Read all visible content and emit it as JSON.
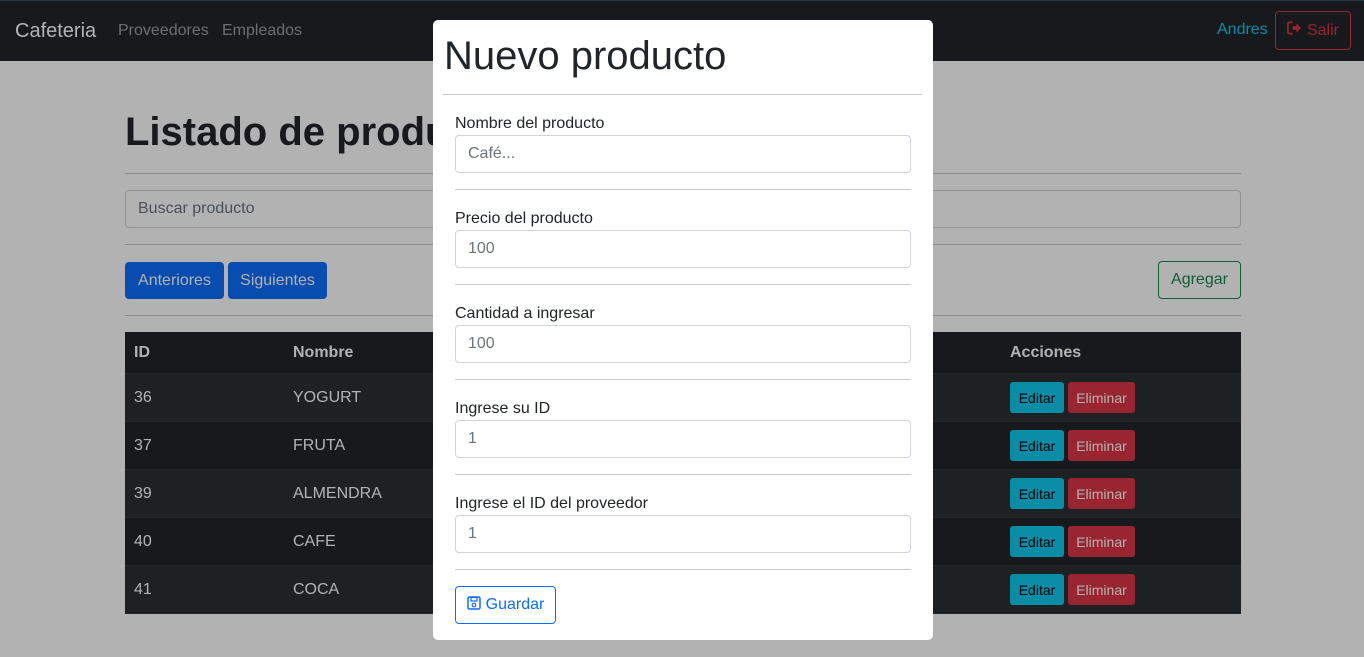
{
  "navbar": {
    "brand": "Cafeteria",
    "links": [
      "Proveedores",
      "Empleados"
    ],
    "user": "Andres",
    "logout_label": "Salir"
  },
  "page": {
    "title": "Listado de productos",
    "search_placeholder": "Buscar producto",
    "prev_label": "Anteriores",
    "next_label": "Siguientes",
    "add_label": "Agregar"
  },
  "table": {
    "headers": [
      "ID",
      "Nombre",
      "Acciones"
    ],
    "rows": [
      {
        "id": "36",
        "name": "YOGURT"
      },
      {
        "id": "37",
        "name": "FRUTA"
      },
      {
        "id": "39",
        "name": "ALMENDRA"
      },
      {
        "id": "40",
        "name": "CAFE"
      },
      {
        "id": "41",
        "name": "COCA"
      }
    ],
    "edit_label": "Editar",
    "delete_label": "Eliminar"
  },
  "modal": {
    "title": "Nuevo producto",
    "fields": [
      {
        "label": "Nombre del producto",
        "placeholder": "Café..."
      },
      {
        "label": "Precio del producto",
        "placeholder": "100"
      },
      {
        "label": "Cantidad a ingresar",
        "placeholder": "100"
      },
      {
        "label": "Ingrese su ID",
        "placeholder": "1"
      },
      {
        "label": "Ingrese el ID del proveedor",
        "placeholder": "1"
      }
    ],
    "save_label": "Guardar"
  },
  "colors": {
    "navbar_bg": "#212529",
    "primary": "#0d6efd",
    "success": "#198754",
    "danger": "#dc3545",
    "info": "#0dcaf0"
  },
  "icons": {
    "logout": "sign-out-icon",
    "save": "floppy-disk-icon"
  }
}
